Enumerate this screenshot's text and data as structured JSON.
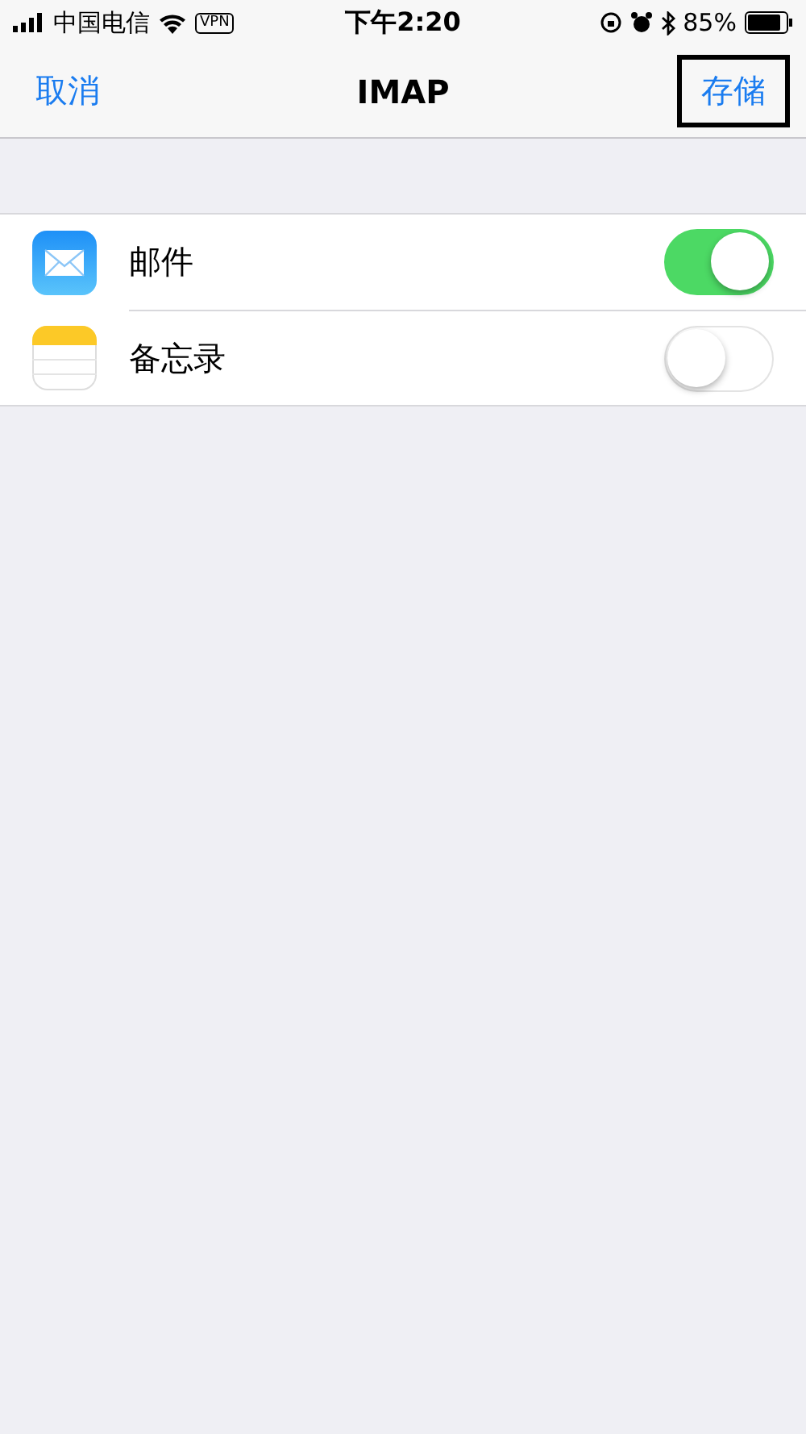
{
  "status_bar": {
    "carrier": "中国电信",
    "vpn": "VPN",
    "time": "下午2:20",
    "battery": "85%"
  },
  "nav": {
    "cancel": "取消",
    "title": "IMAP",
    "save": {
      "label": "存储",
      "highlighted": true
    }
  },
  "items": [
    {
      "kind": "mail",
      "label": "邮件",
      "on": true
    },
    {
      "kind": "notes",
      "label": "备忘录",
      "on": false
    }
  ]
}
